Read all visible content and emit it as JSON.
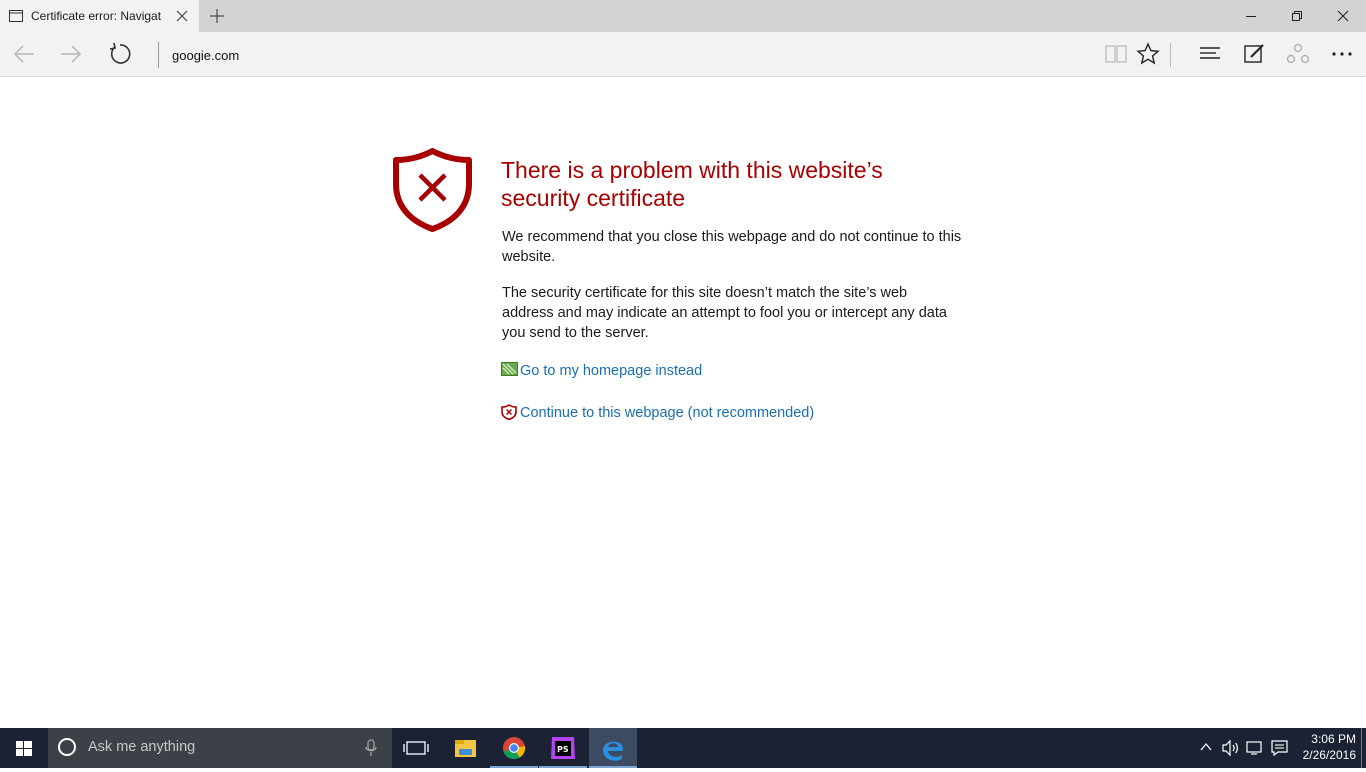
{
  "browser": {
    "tab": {
      "title": "Certificate error: Navigat",
      "icon": "page-icon",
      "close_icon": "close-icon"
    },
    "new_tab_icon": "plus-icon",
    "window_controls": [
      "minimize-icon",
      "restore-icon",
      "close-icon"
    ],
    "address": "googie.com",
    "nav_icons": [
      "back-icon",
      "forward-icon",
      "refresh-icon"
    ],
    "toolbar_icons": [
      "reading-view-icon",
      "favorite-star-icon",
      "hub-icon",
      "web-note-icon",
      "share-icon",
      "more-icon"
    ]
  },
  "page": {
    "heading": "There is a problem with this website’s security certificate",
    "recommend": "We recommend that you close this webpage and do not continue to this website.",
    "explanation": "The security certificate for this site doesn’t match the site’s web address and may indicate an attempt to fool you or intercept any data you send to the server.",
    "homepage_link": "Go to my homepage instead",
    "continue_link": "Continue to this webpage (not recommended)",
    "colors": {
      "heading": "#a80000",
      "link": "#1a6fb0",
      "shield": "#a80000"
    }
  },
  "taskbar": {
    "search_placeholder": "Ask me anything",
    "apps": [
      "task-view-icon",
      "file-explorer-icon",
      "chrome-icon",
      "phpstorm-icon",
      "edge-icon"
    ],
    "active_app": "edge-icon",
    "tray_icons": [
      "chevron-up-icon",
      "volume-icon",
      "network-icon",
      "action-center-icon"
    ],
    "time": "3:06 PM",
    "date": "2/26/2016"
  }
}
